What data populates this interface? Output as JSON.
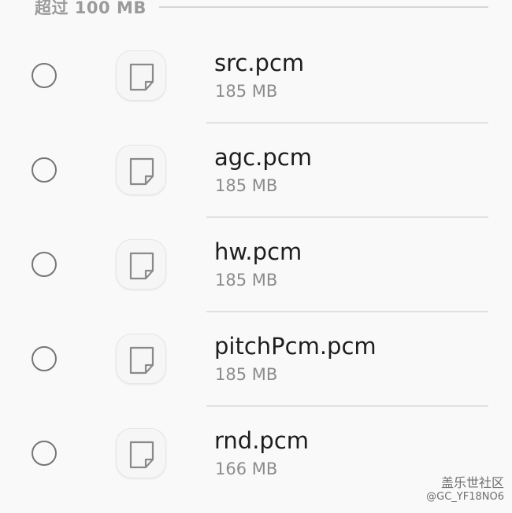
{
  "section": {
    "title": "超过 100 MB"
  },
  "files": [
    {
      "name": "src.pcm",
      "size": "185 MB",
      "icon": "document-icon"
    },
    {
      "name": "agc.pcm",
      "size": "185 MB",
      "icon": "document-icon"
    },
    {
      "name": "hw.pcm",
      "size": "185 MB",
      "icon": "document-icon"
    },
    {
      "name": "pitchPcm.pcm",
      "size": "185 MB",
      "icon": "document-icon"
    },
    {
      "name": "rnd.pcm",
      "size": "166 MB",
      "icon": "document-icon"
    }
  ],
  "watermark": {
    "name": "盖乐世社区",
    "user": "@GC_YF18NO6"
  },
  "colors": {
    "background": "#f9f9f9",
    "radio_border": "#757575",
    "text_primary": "#1d1d1d",
    "text_secondary": "#8c8c8c"
  }
}
